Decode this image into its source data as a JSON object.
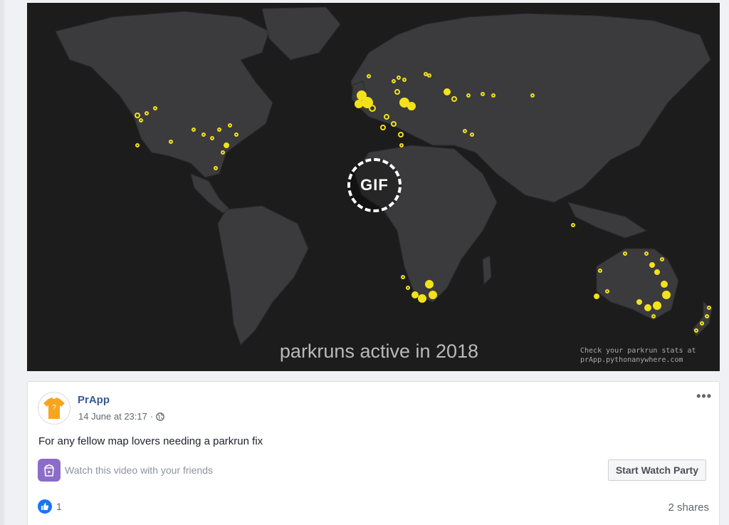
{
  "media": {
    "gif_label": "GIF",
    "caption": "parkruns active in 2018",
    "credit_line1": "Check your parkrun stats at",
    "credit_line2": "prApp.pythonanywhere.com",
    "colors": {
      "background": "#1c1c1d",
      "land": "#3b3b3d",
      "marker": "#f3e21a"
    }
  },
  "post": {
    "author": "PrApp",
    "timestamp": "14 June at 23:17",
    "privacy_icon": "globe-icon",
    "more_icon": "more-options-icon",
    "more_label": "•••",
    "text": "For any fellow map lovers needing a parkrun fix",
    "watch_party": {
      "icon": "watch-party-icon",
      "prompt": "Watch this video with your friends",
      "button_label": "Start Watch Party"
    },
    "reactions": {
      "icon": "like-icon",
      "count": "1"
    },
    "shares": "2 shares"
  }
}
